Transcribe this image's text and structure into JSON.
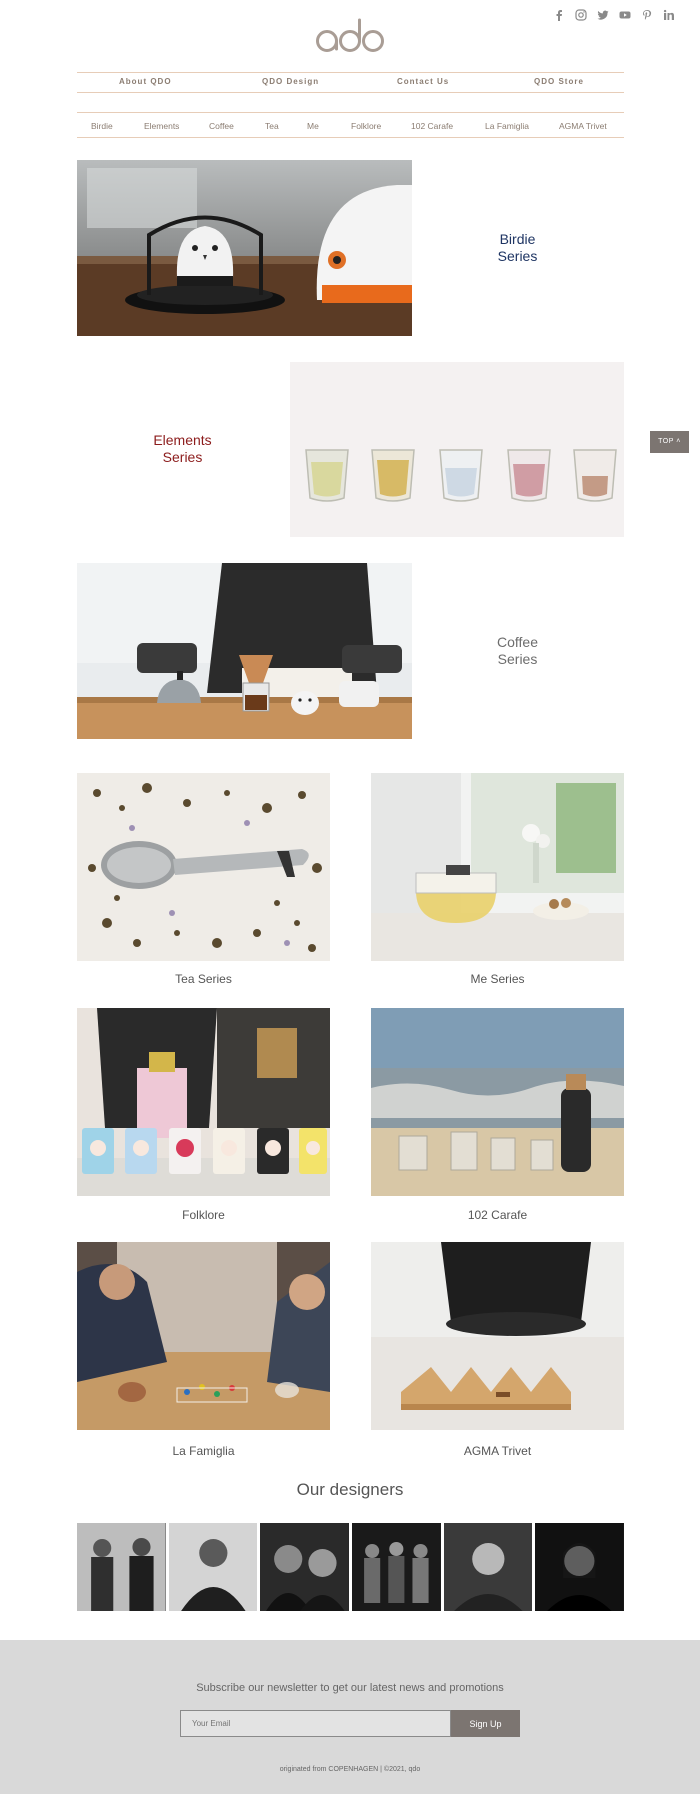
{
  "brand": {
    "logo_text": "qdo"
  },
  "social": [
    "facebook-icon",
    "instagram-icon",
    "twitter-icon",
    "youtube-icon",
    "pinterest-icon",
    "linkedin-icon"
  ],
  "main_nav": [
    {
      "label": "About QDO"
    },
    {
      "label": "QDO Design"
    },
    {
      "label": "Contact Us"
    },
    {
      "label": "QDO Store"
    }
  ],
  "series_nav": [
    {
      "label": "Birdie"
    },
    {
      "label": "Elements"
    },
    {
      "label": "Coffee"
    },
    {
      "label": "Tea"
    },
    {
      "label": "Me"
    },
    {
      "label": "Folklore"
    },
    {
      "label": "102 Carafe"
    },
    {
      "label": "La Famiglia"
    },
    {
      "label": "AGMA Trivet"
    }
  ],
  "features": {
    "birdie": {
      "line1": "Birdie",
      "line2": "Series",
      "color": "#1f3563"
    },
    "elements": {
      "line1": "Elements",
      "line2": "Series",
      "color": "#8c1c1c"
    },
    "coffee": {
      "line1": "Coffee",
      "line2": "Series",
      "color": "#6d6d6d"
    }
  },
  "tiles": [
    {
      "caption": "Tea Series"
    },
    {
      "caption": "Me Series"
    },
    {
      "caption": "Folklore"
    },
    {
      "caption": "102 Carafe"
    },
    {
      "caption": "La Famiglia"
    },
    {
      "caption": "AGMA Trivet"
    }
  ],
  "designers": {
    "title": "Our designers",
    "count": 6
  },
  "top_button": {
    "label": "TOP ˄"
  },
  "footer": {
    "newsletter_text": "Subscribe our newsletter to get our latest news and promotions",
    "email_placeholder": "Your Email",
    "signup_label": "Sign Up",
    "copyright": "originated from COPENHAGEN  |  ©2021, qdo"
  },
  "colors": {
    "accent_line": "#e7cdb8",
    "nav_text": "#8b7d72",
    "button": "#7c7571",
    "footer_bg": "#d9d9d9"
  }
}
